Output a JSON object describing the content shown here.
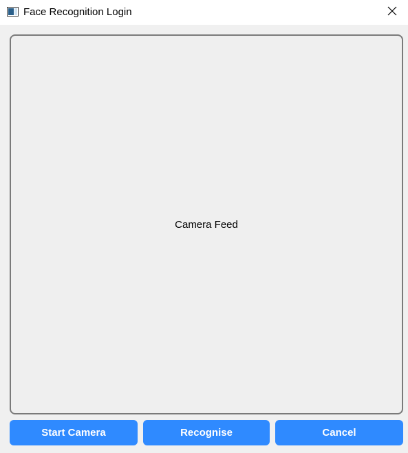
{
  "window": {
    "title": "Face Recognition Login",
    "app_icon": "window-app-icon",
    "close_icon": "close-icon"
  },
  "camera": {
    "label": "Camera Feed"
  },
  "buttons": {
    "start_camera": "Start Camera",
    "recognise": "Recognise",
    "cancel": "Cancel"
  },
  "colors": {
    "accent": "#2f8aff",
    "panel_border": "#7a7a7a",
    "background": "#f0f0f0"
  }
}
